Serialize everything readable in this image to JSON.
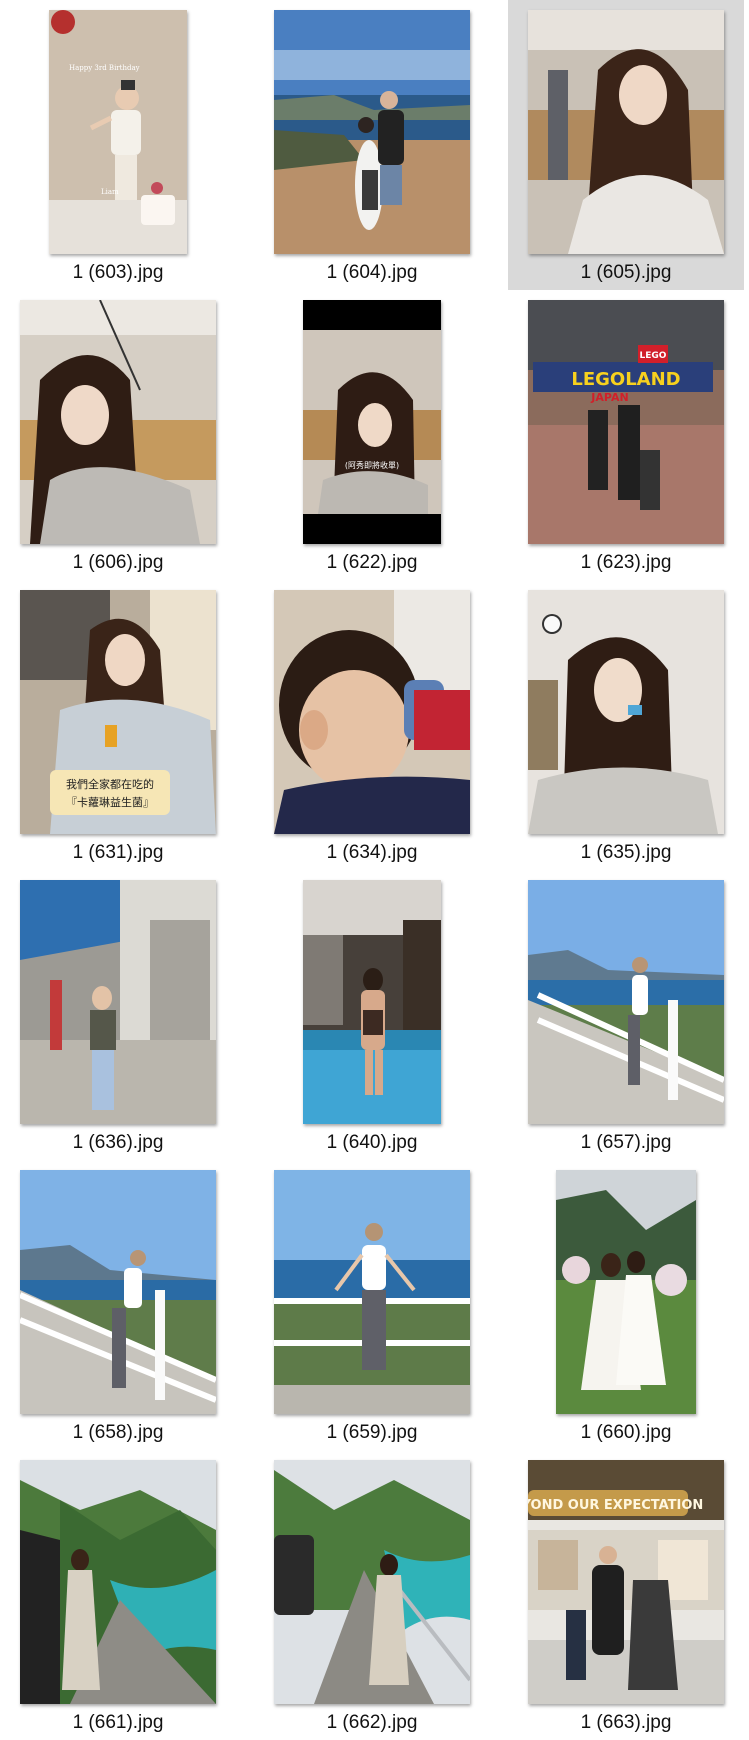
{
  "explorer": {
    "view": "large-icons",
    "selected_index": 2,
    "files": [
      {
        "name": "1 (603).jpg",
        "thumb": "portrait-narrow",
        "scene": "birthday-child"
      },
      {
        "name": "1 (604).jpg",
        "thumb": "portrait-wide",
        "scene": "family-seaside"
      },
      {
        "name": "1 (605).jpg",
        "thumb": "portrait-wide",
        "scene": "cafe-selfie"
      },
      {
        "name": "1 (606).jpg",
        "thumb": "portrait-wide",
        "scene": "cafe-selfie"
      },
      {
        "name": "1 (622).jpg",
        "thumb": "portrait-narrow",
        "scene": "cafe-selfie-video"
      },
      {
        "name": "1 (623).jpg",
        "thumb": "portrait-wide",
        "scene": "legoland-family"
      },
      {
        "name": "1 (631).jpg",
        "thumb": "portrait-wide",
        "scene": "snack"
      },
      {
        "name": "1 (634).jpg",
        "thumb": "portrait-wide",
        "scene": "child-drinking"
      },
      {
        "name": "1 (635).jpg",
        "thumb": "portrait-wide",
        "scene": "indoor-portrait"
      },
      {
        "name": "1 (636).jpg",
        "thumb": "portrait-wide",
        "scene": "street"
      },
      {
        "name": "1 (640).jpg",
        "thumb": "portrait-narrow",
        "scene": "pool"
      },
      {
        "name": "1 (657).jpg",
        "thumb": "portrait-wide",
        "scene": "coast-fence"
      },
      {
        "name": "1 (658).jpg",
        "thumb": "portrait-wide",
        "scene": "coast-fence"
      },
      {
        "name": "1 (659).jpg",
        "thumb": "portrait-wide",
        "scene": "coast-fence-front"
      },
      {
        "name": "1 (660).jpg",
        "thumb": "portrait-narrow",
        "scene": "wedding"
      },
      {
        "name": "1 (661).jpg",
        "thumb": "portrait-wide",
        "scene": "gorge"
      },
      {
        "name": "1 (662).jpg",
        "thumb": "portrait-wide",
        "scene": "gorge-road"
      },
      {
        "name": "1 (663).jpg",
        "thumb": "portrait-wide",
        "scene": "mall-family"
      }
    ],
    "thumb_text": {
      "t603_caption": "Happy 3rd Birthday",
      "t603_name": "Liam",
      "t622_caption": "(阿秀即將收單)",
      "t623_logo": "LEGOLAND",
      "t623_sub": "JAPAN",
      "t623_badge": "LEGO",
      "t631_caption_1": "我們全家都在吃的",
      "t631_caption_2": "『卡蘿琳益生菌』",
      "t663_sign": "EYOND OUR EXPECTATION"
    }
  }
}
